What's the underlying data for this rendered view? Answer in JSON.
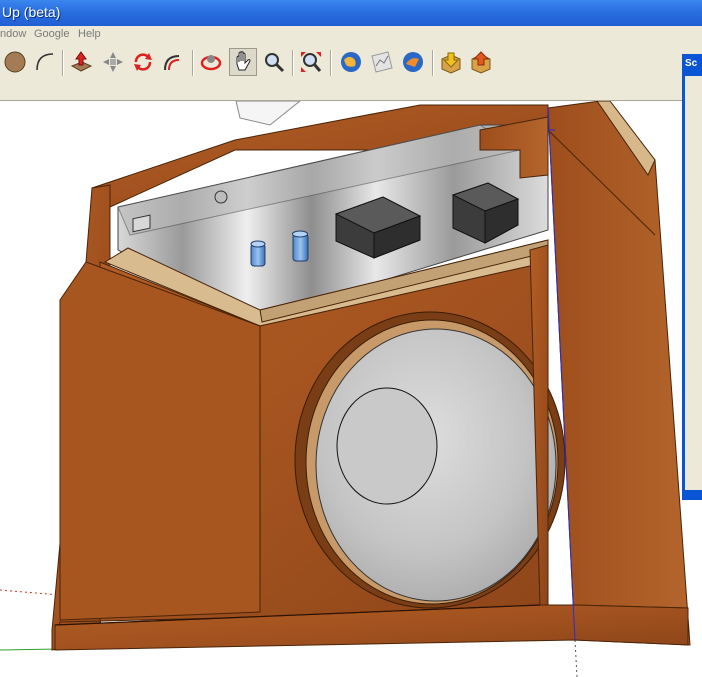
{
  "window": {
    "title": "Up (beta)"
  },
  "menu": [
    "ndow",
    "Google",
    "Help"
  ],
  "toolbar": {
    "tools": [
      "circle-icon",
      "arc-icon",
      "push-pull-icon",
      "move-icon",
      "rotate-icon",
      "follow-me-icon",
      "orbit-icon",
      "pan-icon",
      "zoom-icon",
      "zoom-extents-icon",
      "get-current-view-icon",
      "toggle-terrain-icon",
      "place-model-icon",
      "get-models-icon",
      "share-model-icon"
    ],
    "active_tool": "pan-icon"
  },
  "side_panel": {
    "title": "Sc"
  },
  "colors": {
    "title_bar": "#2a6fe0",
    "toolbar_bg": "#ece9d8",
    "wood": "#a2521f",
    "metal": "#c9c9c9"
  }
}
